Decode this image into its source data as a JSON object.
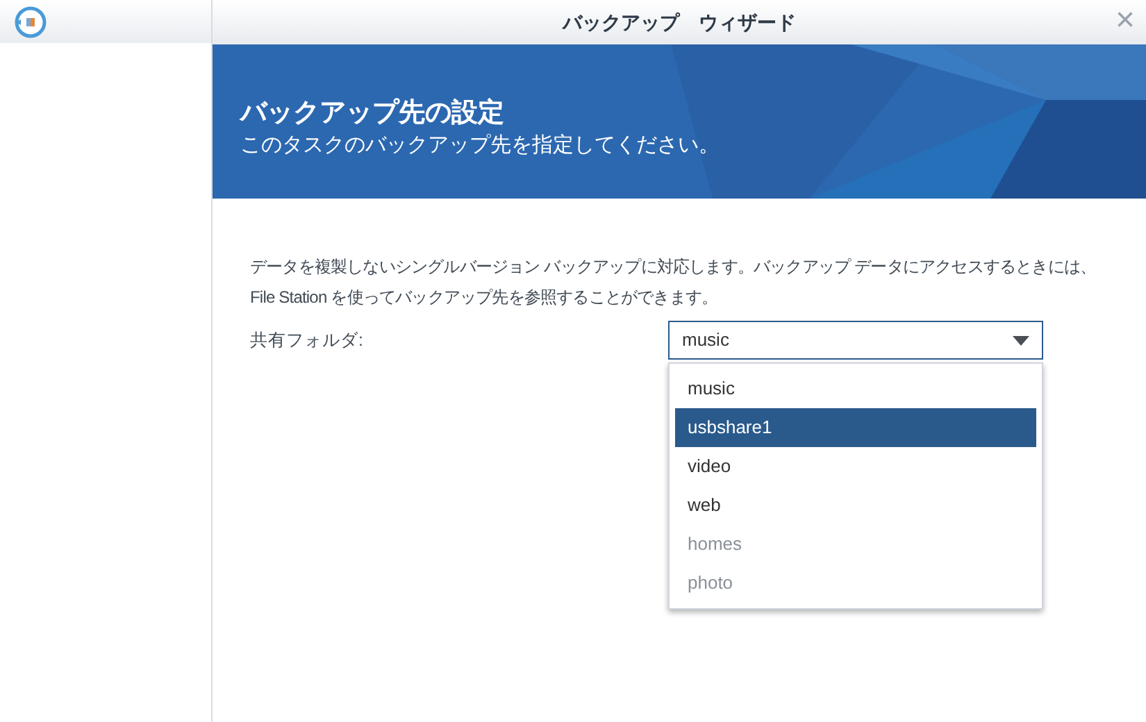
{
  "window": {
    "title": "バックアップ　ウィザード",
    "close": "×"
  },
  "banner": {
    "title": "バックアップ先の設定",
    "subtitle": "このタスクのバックアップ先を指定してください。"
  },
  "description": "データを複製しないシングルバージョン バックアップに対応します。バックアップ データにアクセスするときには、File Station を使ってバックアップ先を参照することができます。",
  "shared_folder": {
    "label": "共有フォルダ:",
    "value": "music",
    "expanded": true,
    "options": [
      {
        "label": "music",
        "highlighted": false,
        "disabled": false
      },
      {
        "label": "usbshare1",
        "highlighted": true,
        "disabled": false
      },
      {
        "label": "video",
        "highlighted": false,
        "disabled": false
      },
      {
        "label": "web",
        "highlighted": false,
        "disabled": false
      },
      {
        "label": "homes",
        "highlighted": false,
        "disabled": true
      },
      {
        "label": "photo",
        "highlighted": false,
        "disabled": true
      }
    ]
  }
}
